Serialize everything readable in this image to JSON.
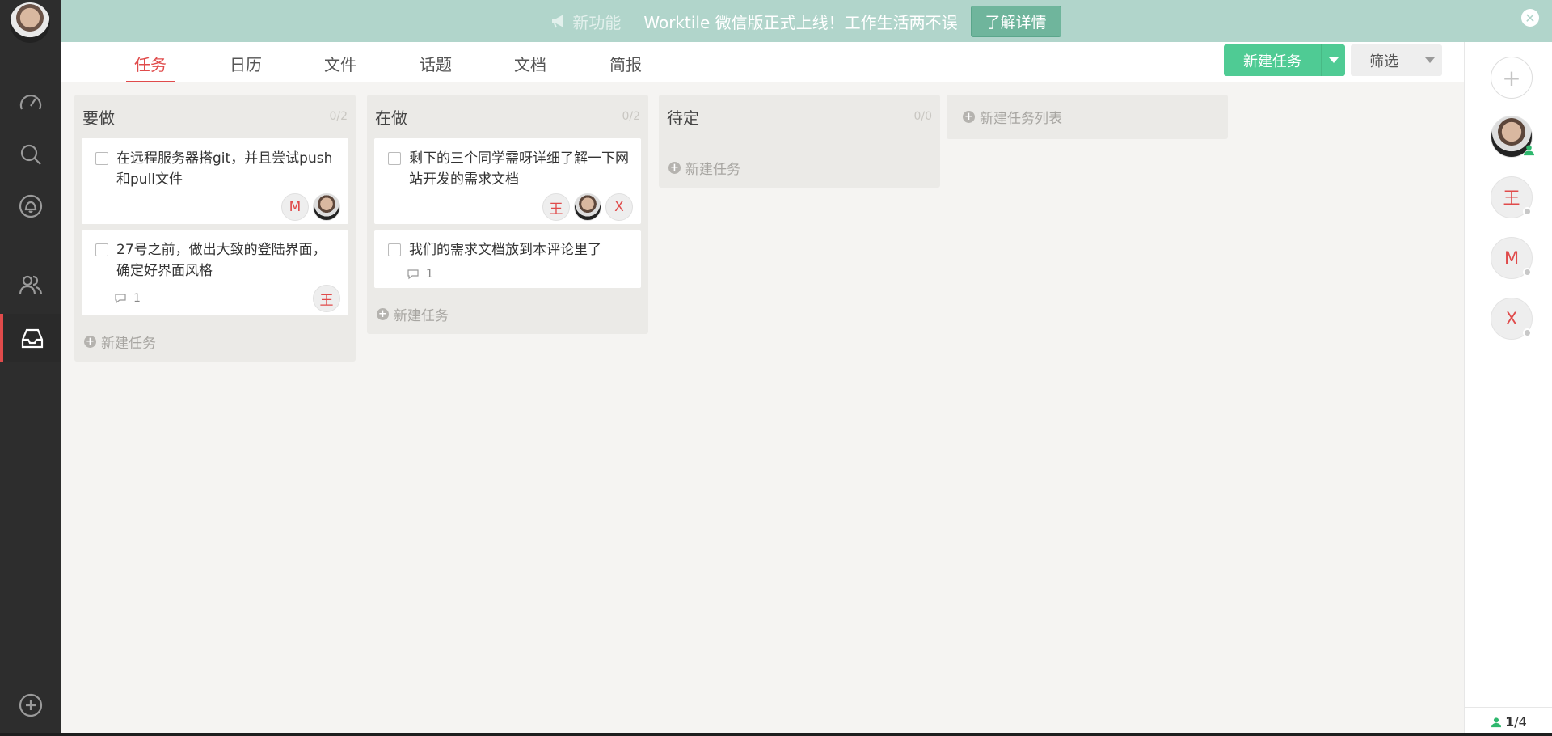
{
  "banner": {
    "new_label": "新功能",
    "message": "Worktile 微信版正式上线！工作生活两不误",
    "learn_more": "了解详情",
    "close": "✕"
  },
  "tabs": [
    "任务",
    "日历",
    "文件",
    "话题",
    "文档",
    "简报"
  ],
  "toolbar": {
    "new_task": "新建任务",
    "filter": "筛选"
  },
  "columns": [
    {
      "title": "要做",
      "count": "0/2",
      "cards": [
        {
          "text": "在远程服务器搭git，并且尝试push和pull文件",
          "comments": "",
          "assignees": [
            "M",
            "photo"
          ]
        },
        {
          "text": "27号之前，做出大致的登陆界面，确定好界面风格",
          "comments": "1",
          "assignees": [
            "王"
          ]
        }
      ],
      "add_task": "新建任务"
    },
    {
      "title": "在做",
      "count": "0/2",
      "cards": [
        {
          "text": "剩下的三个同学需呀详细了解一下网站开发的需求文档",
          "comments": "",
          "assignees": [
            "王",
            "photo",
            "X"
          ]
        },
        {
          "text": "我们的需求文档放到本评论里了",
          "comments": "1",
          "assignees": []
        }
      ],
      "add_task": "新建任务"
    },
    {
      "title": "待定",
      "count": "0/0",
      "cards": [],
      "add_task": "新建任务"
    }
  ],
  "new_list": "新建任务列表",
  "members": {
    "items": [
      "photo",
      "王",
      "M",
      "X"
    ],
    "online_count": "1",
    "total": "/4"
  },
  "colors": {
    "accent": "#e04b4b",
    "primary": "#4fcb94",
    "banner": "#b1d5cb"
  },
  "icons": [
    "dashboard-icon",
    "search-icon",
    "bell-icon",
    "team-icon",
    "inbox-icon",
    "add-icon"
  ]
}
